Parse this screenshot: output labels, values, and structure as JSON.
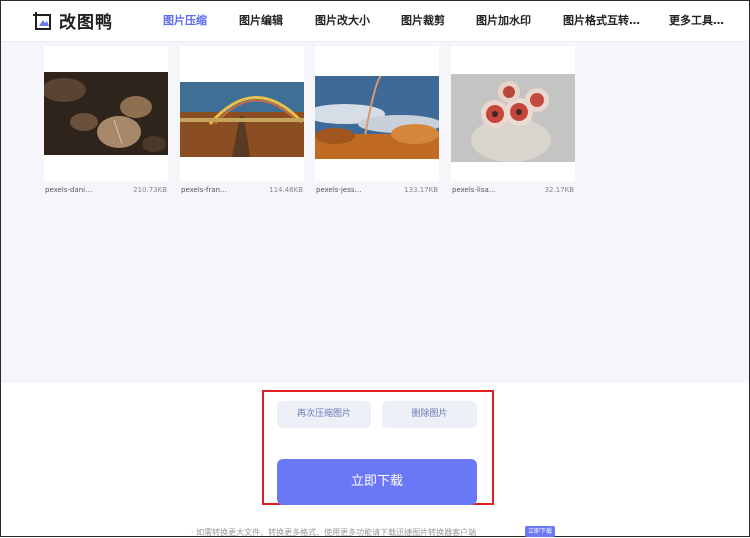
{
  "brand": {
    "name": "改图鸭"
  },
  "nav": {
    "items": [
      {
        "label": "图片压缩",
        "active": true
      },
      {
        "label": "图片编辑",
        "active": false
      },
      {
        "label": "图片改大小",
        "active": false
      },
      {
        "label": "图片裁剪",
        "active": false
      },
      {
        "label": "图片加水印",
        "active": false
      },
      {
        "label": "图片格式互转…",
        "active": false
      },
      {
        "label": "更多工具…",
        "active": false
      }
    ]
  },
  "files": [
    {
      "name": "pexels-dani…",
      "size": "210.73KB"
    },
    {
      "name": "pexels-fran…",
      "size": "114.48KB"
    },
    {
      "name": "pexels-jess…",
      "size": "133.17KB"
    },
    {
      "name": "pexels-lisa…",
      "size": "32.17KB"
    }
  ],
  "actions": {
    "recompress_label": "再次压缩图片",
    "delete_label": "删除图片",
    "download_label": "立即下载"
  },
  "footer": {
    "note": "· 如需转换更大文件、转换更多格式、使用更多功能请下载迅捷图片转换器客户端",
    "button_label": "立即下载"
  },
  "colors": {
    "accent": "#6b78f5",
    "highlight_border": "#e02020",
    "gallery_bg": "#f6f6fa"
  }
}
